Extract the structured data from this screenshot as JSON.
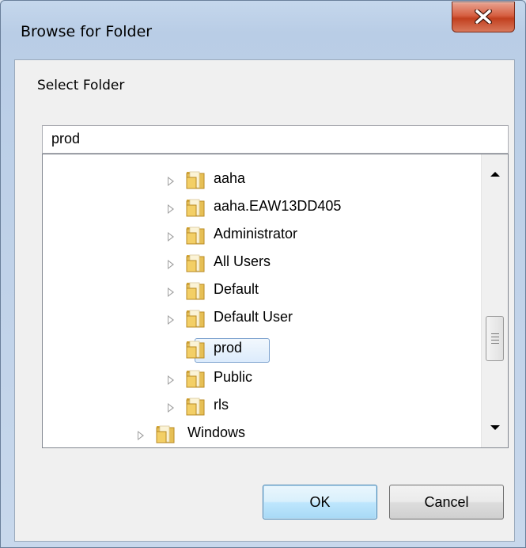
{
  "window": {
    "title": "Browse for Folder"
  },
  "dialog": {
    "caption": "Select Folder",
    "path_value": "prod",
    "ok_label": "OK",
    "cancel_label": "Cancel"
  },
  "tree": {
    "items": [
      {
        "label": "aaha",
        "has_children": true
      },
      {
        "label": "aaha.EAW13DD405",
        "has_children": true
      },
      {
        "label": "Administrator",
        "has_children": true
      },
      {
        "label": "All Users",
        "has_children": true
      },
      {
        "label": "Default",
        "has_children": true
      },
      {
        "label": "Default User",
        "has_children": true
      },
      {
        "label": "prod",
        "has_children": false,
        "selected": true
      },
      {
        "label": "Public",
        "has_children": true
      },
      {
        "label": "rls",
        "has_children": true
      },
      {
        "label": "Windows",
        "has_children": true
      }
    ]
  },
  "colors": {
    "selection_border": "#7da2ce",
    "close_button": "#c2401f",
    "ok_button_border": "#3c7fb1"
  },
  "icons": [
    "close-icon",
    "folder-icon",
    "expand-arrow-icon",
    "scroll-up-icon",
    "scroll-down-icon"
  ]
}
